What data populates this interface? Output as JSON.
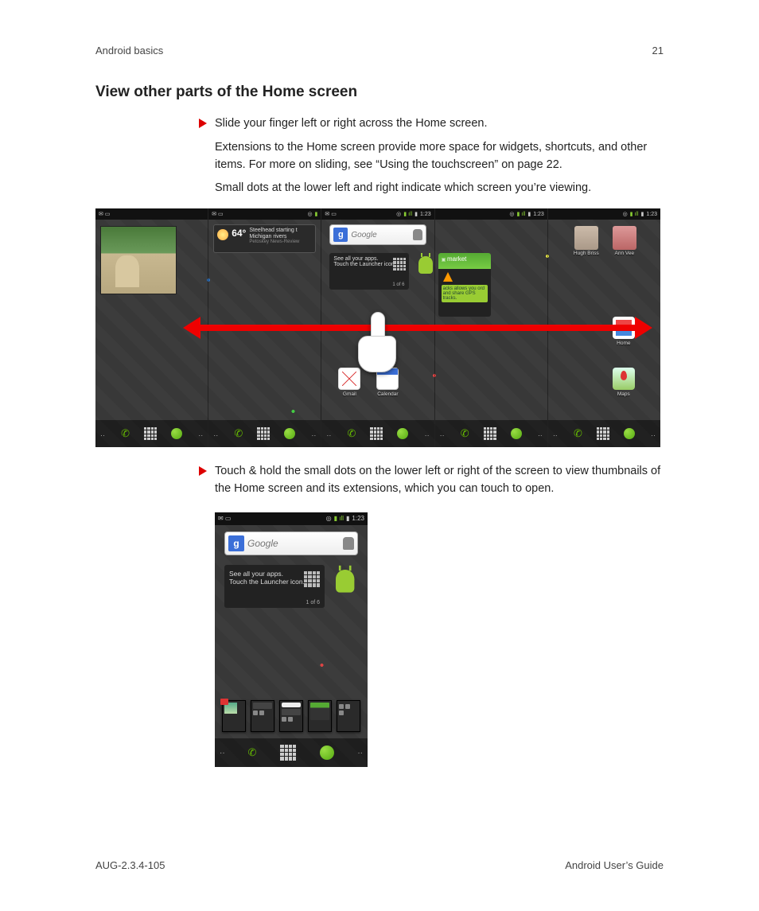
{
  "header": {
    "left": "Android basics",
    "right": "21"
  },
  "section_title": "View other parts of the Home screen",
  "bullets": [
    "Slide your finger left or right across the Home screen.",
    "Touch & hold the small dots on the lower left or right of the screen to view thumbnails of the Home screen and its extensions, which you can touch to open."
  ],
  "paras": [
    "Extensions to the Home screen provide more space for widgets, shortcuts, and other items. For more on sliding, see “Using the touchscreen” on page 22.",
    "Small dots at the lower left and right indicate which screen you’re viewing."
  ],
  "status": {
    "time": "1:23"
  },
  "weather": {
    "temp": "64°",
    "line1": "Steelhead starting t",
    "line2": "Michigan rivers",
    "source": "Petoskey News-Review"
  },
  "search": {
    "placeholder": "Google",
    "g": "g"
  },
  "tip": {
    "line1": "See all your apps.",
    "line2": "Touch the Launcher icon.",
    "count": "1 of 6"
  },
  "apps": {
    "gmail": "Gmail",
    "calendar": "Calendar",
    "home": "Home",
    "maps": "Maps"
  },
  "market": {
    "title": "market",
    "tagline": "acks allows you ord and share GPS tracks."
  },
  "contacts": {
    "hugh": "Hugh Briss",
    "ann": "Ann Vee"
  },
  "pager": {
    "left": "··",
    "right": "··"
  },
  "footer": {
    "left": "AUG-2.3.4-105",
    "right": "Android User’s Guide"
  }
}
